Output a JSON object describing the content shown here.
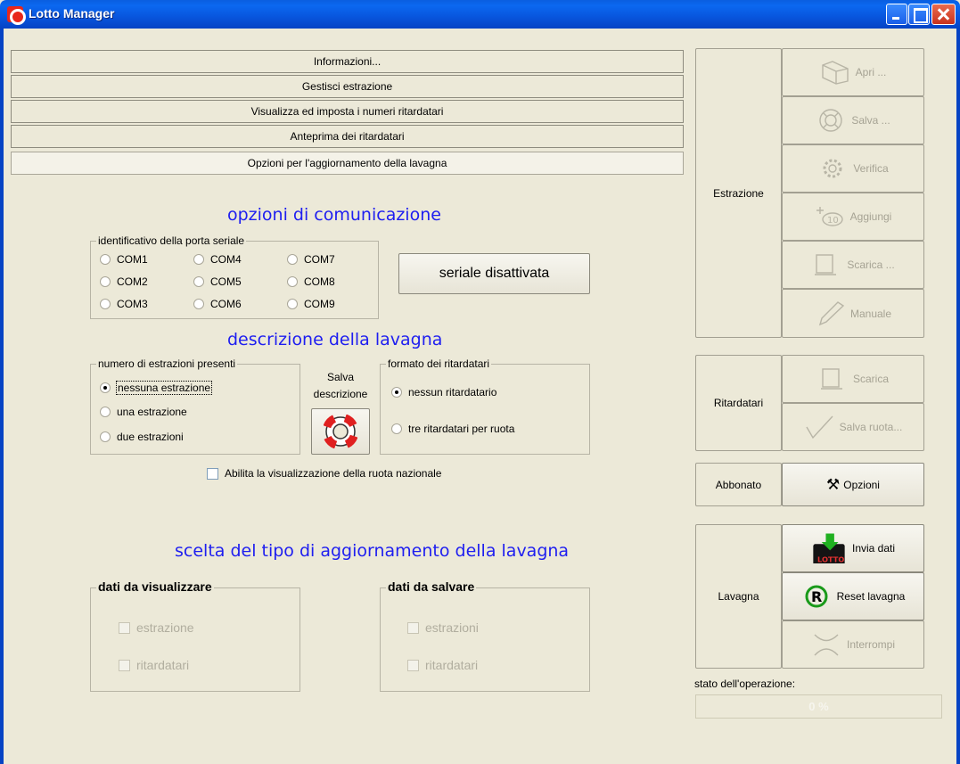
{
  "window": {
    "title": "Lotto Manager"
  },
  "accordion": [
    {
      "label": "Informazioni..."
    },
    {
      "label": "Gestisci estrazione"
    },
    {
      "label": "Visualizza ed imposta i numeri ritardatari"
    },
    {
      "label": "Anteprima dei ritardatari"
    },
    {
      "label": "Opzioni per l'aggiornamento della lavagna"
    }
  ],
  "comm": {
    "title": "opzioni di comunicazione",
    "port_group_label": "identificativo della porta seriale",
    "ports": [
      "COM1",
      "COM4",
      "COM7",
      "COM2",
      "COM5",
      "COM8",
      "COM3",
      "COM6",
      "COM9"
    ],
    "serial_button": "seriale disattivata"
  },
  "board": {
    "title": "descrizione della lavagna",
    "draws_group_label": "numero di estrazioni presenti",
    "draws_options": [
      "nessuna estrazione",
      "una estrazione",
      "due estrazioni"
    ],
    "save_label_1": "Salva",
    "save_label_2": "descrizione",
    "late_group_label": "formato dei ritardatari",
    "late_options": [
      "nessun ritardatario",
      "tre ritardatari per ruota"
    ],
    "national_wheel_label": "Abilita la visualizzazione della ruota nazionale"
  },
  "update": {
    "title": "scelta del tipo di aggiornamento della lavagna",
    "show_group_label": "dati da visualizzare",
    "show_items": [
      "estrazione",
      "ritardatari"
    ],
    "save_group_label": "dati da salvare",
    "save_items": [
      "estrazioni",
      "ritardatari"
    ]
  },
  "sidebar": {
    "estrazione_label": "Estrazione",
    "estrazione_buttons": [
      "Apri ...",
      "Salva ...",
      "Verifica",
      "Aggiungi",
      "Scarica ...",
      "Manuale"
    ],
    "ritardatari_label": "Ritardatari",
    "ritardatari_buttons": [
      "Scarica",
      "Salva ruota..."
    ],
    "abbonato_label": "Abbonato",
    "opzioni_label": "Opzioni",
    "lavagna_label": "Lavagna",
    "lavagna_buttons": [
      "Invia dati",
      "Reset lavagna",
      "Interrompi"
    ],
    "status_label": "stato dell'operazione:",
    "progress_text": "0 %"
  }
}
